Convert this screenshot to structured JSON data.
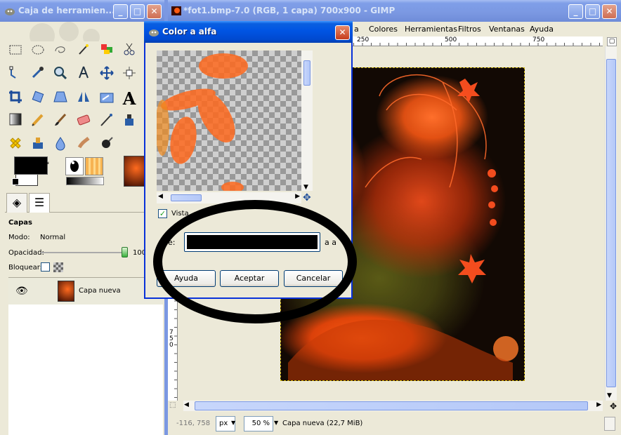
{
  "toolbox": {
    "title": "Caja de herramien...",
    "buttons": {
      "minimize": "_",
      "maximize": "□",
      "close": "✕"
    },
    "tools": [
      "rect-select",
      "ellipse-select",
      "free-select",
      "fuzzy-select",
      "color-select",
      "scissors",
      "paths",
      "color-picker",
      "magnify",
      "measure",
      "move",
      "align",
      "crop",
      "rotate",
      "perspective",
      "flip",
      "scale",
      "text",
      "bucket-fill",
      "pencil",
      "paintbrush",
      "eraser",
      "airbrush",
      "ink",
      "heal",
      "clone",
      "blur",
      "smudge",
      "dodge-burn"
    ],
    "text_tool_glyph": "A",
    "layers_panel": {
      "title": "Capas",
      "mode_label": "Modo:",
      "mode_value": "Normal",
      "opacity_label": "Opacidad:",
      "opacity_value": "100",
      "opacity_level": 1.0,
      "lock_label": "Bloquear:",
      "layers": [
        {
          "name": "Capa nueva",
          "visible": true
        }
      ]
    }
  },
  "image_window": {
    "title": "*fot1.bmp-7.0 (RGB, 1 capa) 700x900 - GIMP",
    "buttons": {
      "minimize": "_",
      "maximize": "□",
      "close": "✕"
    },
    "menu": [
      "a",
      "Colores",
      "Herramientas",
      "Filtros",
      "Ventanas",
      "Ayuda"
    ],
    "ruler_ticks": [
      "250",
      "500",
      "750"
    ],
    "vruler_text": "7 5 0",
    "status": {
      "coords": "-116, 758",
      "unit": "px",
      "zoom": "50 %",
      "layer_info": "Capa nueva (22,7 MiB)"
    }
  },
  "dialog": {
    "title": "Color a alfa",
    "preview_checkbox_label": "Vista",
    "preview_checked": true,
    "from_label": "de:",
    "to_label": "a a",
    "color": "#000000",
    "buttons": {
      "help": "Ayuda",
      "ok": "Aceptar",
      "cancel": "Cancelar"
    },
    "close": "✕"
  }
}
